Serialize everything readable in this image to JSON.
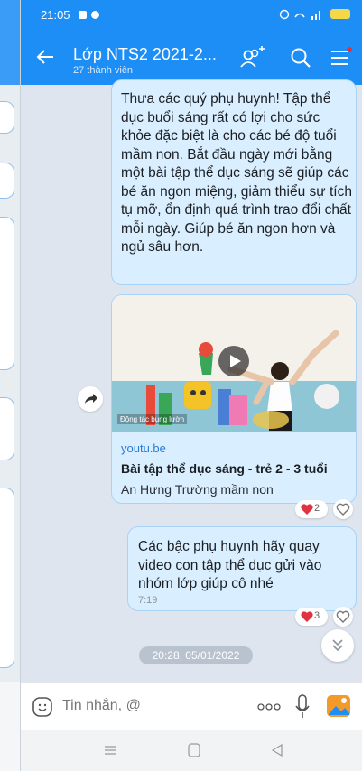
{
  "status": {
    "time": "21:05"
  },
  "header": {
    "title": "Lớp NTS2 2021-2...",
    "subtitle": "27 thành viên"
  },
  "messages": {
    "m1_text": "Thưa các quý phụ huynh! Tập thể dục buổi sáng rất có lợi cho sức khỏe đặc biệt là cho các bé độ tuổi mầm non. Bắt đầu ngày mới bằng một bài tập thể dục sáng sẽ giúp các bé ăn ngon miệng, giảm thiểu sự tích tụ mỡ, ổn định quá trình trao đổi chất mỗi ngày. Giúp bé ăn ngon hơn và ngủ sâu hơn.",
    "link": {
      "domain": "youtu.be",
      "title": "Bài tập thể dục sáng - trẻ 2 - 3 tuổi",
      "source": "An Hưng Trường mầm non",
      "thumb_caption": "Động tác bụng lườn"
    },
    "link_reactions": "2",
    "m2_text": "Các bậc phụ huynh hãy quay video con tập thể dục gửi vào nhóm lớp giúp cô nhé",
    "m2_time": "7:19",
    "m2_reactions": "3"
  },
  "date_badge": "20:28, 05/01/2022",
  "input": {
    "placeholder": "Tin nhắn, @"
  },
  "colors": {
    "header": "#1e8ef7",
    "bubble": "#d9eefe",
    "bubble_border": "#a9d3f6",
    "link_blue": "#2a7ad4",
    "heart": "#e0323f"
  },
  "icons": [
    "back-arrow-icon",
    "add-member-icon",
    "search-icon",
    "menu-list-icon",
    "share-forward-icon",
    "heart-icon",
    "chevron-double-down-icon",
    "emoji-icon",
    "more-dots-icon",
    "mic-icon",
    "image-icon"
  ]
}
